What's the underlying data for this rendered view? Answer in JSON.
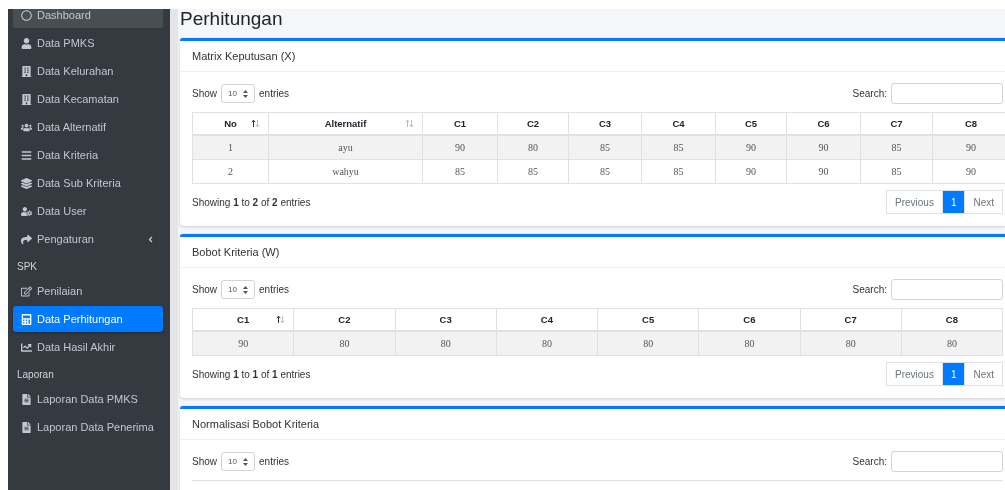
{
  "sidebar": {
    "items": [
      {
        "kind": "link",
        "label": "Dashboard",
        "highlighted": true,
        "selected": false
      },
      {
        "kind": "link",
        "label": "Data PMKS",
        "highlighted": false,
        "selected": false
      },
      {
        "kind": "link",
        "label": "Data Kelurahan",
        "highlighted": false,
        "selected": false
      },
      {
        "kind": "link",
        "label": "Data Kecamatan",
        "highlighted": false,
        "selected": false
      },
      {
        "kind": "link",
        "label": "Data Alternatif",
        "highlighted": false,
        "selected": false
      },
      {
        "kind": "link",
        "label": "Data Kriteria",
        "highlighted": false,
        "selected": false
      },
      {
        "kind": "link",
        "label": "Data Sub Kriteria",
        "highlighted": false,
        "selected": false
      },
      {
        "kind": "link",
        "label": "Data User",
        "highlighted": false,
        "selected": false
      },
      {
        "kind": "link",
        "label": "Pengaturan",
        "highlighted": false,
        "selected": false,
        "expanded": false
      },
      {
        "kind": "header",
        "label": "SPK"
      },
      {
        "kind": "link",
        "label": "Penilaian",
        "highlighted": false,
        "selected": false
      },
      {
        "kind": "link",
        "label": "Data Perhitungan",
        "highlighted": false,
        "selected": true
      },
      {
        "kind": "link",
        "label": "Data Hasil Akhir",
        "highlighted": false,
        "selected": false
      },
      {
        "kind": "header",
        "label": "Laporan"
      },
      {
        "kind": "link",
        "label": "Laporan Data PMKS",
        "highlighted": false,
        "selected": false
      },
      {
        "kind": "link",
        "label": "Laporan Data Penerima",
        "highlighted": false,
        "selected": false
      }
    ]
  },
  "page_title": "Perhitungan",
  "cards": [
    {
      "title": "Matrix Keputusan (X)",
      "show_label": "Show",
      "page_size": "10",
      "entries_label": "entries",
      "search_label": "Search:",
      "table": {
        "columns": [
          {
            "label": "No",
            "sortable": true,
            "sorted_ascending": true
          },
          {
            "label": "Alternatif",
            "sortable": true,
            "sorted_ascending": false
          },
          {
            "label": "C1",
            "sortable": false
          },
          {
            "label": "C2",
            "sortable": false
          },
          {
            "label": "C3",
            "sortable": false
          },
          {
            "label": "C4",
            "sortable": false
          },
          {
            "label": "C5",
            "sortable": false
          },
          {
            "label": "C6",
            "sortable": false
          },
          {
            "label": "C7",
            "sortable": false
          },
          {
            "label": "C8",
            "sortable": false
          }
        ],
        "rows": [
          [
            "1",
            "ayu",
            "90",
            "80",
            "85",
            "85",
            "90",
            "90",
            "85",
            "90"
          ],
          [
            "2",
            "wahyu",
            "85",
            "85",
            "85",
            "85",
            "90",
            "90",
            "85",
            "90"
          ]
        ]
      },
      "info": "Showing **1** to **2** of **2** entries",
      "pagination": [
        {
          "label": "Previous",
          "selected": false
        },
        {
          "label": "1",
          "selected": true
        },
        {
          "label": "Next",
          "selected": false
        }
      ]
    },
    {
      "title": "Bobot Kriteria (W)",
      "show_label": "Show",
      "page_size": "10",
      "entries_label": "entries",
      "search_label": "Search:",
      "table": {
        "columns": [
          {
            "label": "C1",
            "sortable": true,
            "sorted_ascending": true
          },
          {
            "label": "C2",
            "sortable": false
          },
          {
            "label": "C3",
            "sortable": false
          },
          {
            "label": "C4",
            "sortable": false
          },
          {
            "label": "C5",
            "sortable": false
          },
          {
            "label": "C6",
            "sortable": false
          },
          {
            "label": "C7",
            "sortable": false
          },
          {
            "label": "C8",
            "sortable": false
          }
        ],
        "rows": [
          [
            "90",
            "80",
            "80",
            "80",
            "80",
            "80",
            "80",
            "80"
          ]
        ]
      },
      "info": "Showing **1** to **1** of **1** entries",
      "pagination": [
        {
          "label": "Previous",
          "selected": false
        },
        {
          "label": "1",
          "selected": true
        },
        {
          "label": "Next",
          "selected": false
        }
      ]
    },
    {
      "title": "Normalisasi Bobot Kriteria",
      "show_label": "Show",
      "page_size": "10",
      "entries_label": "entries",
      "search_label": "Search:"
    }
  ]
}
